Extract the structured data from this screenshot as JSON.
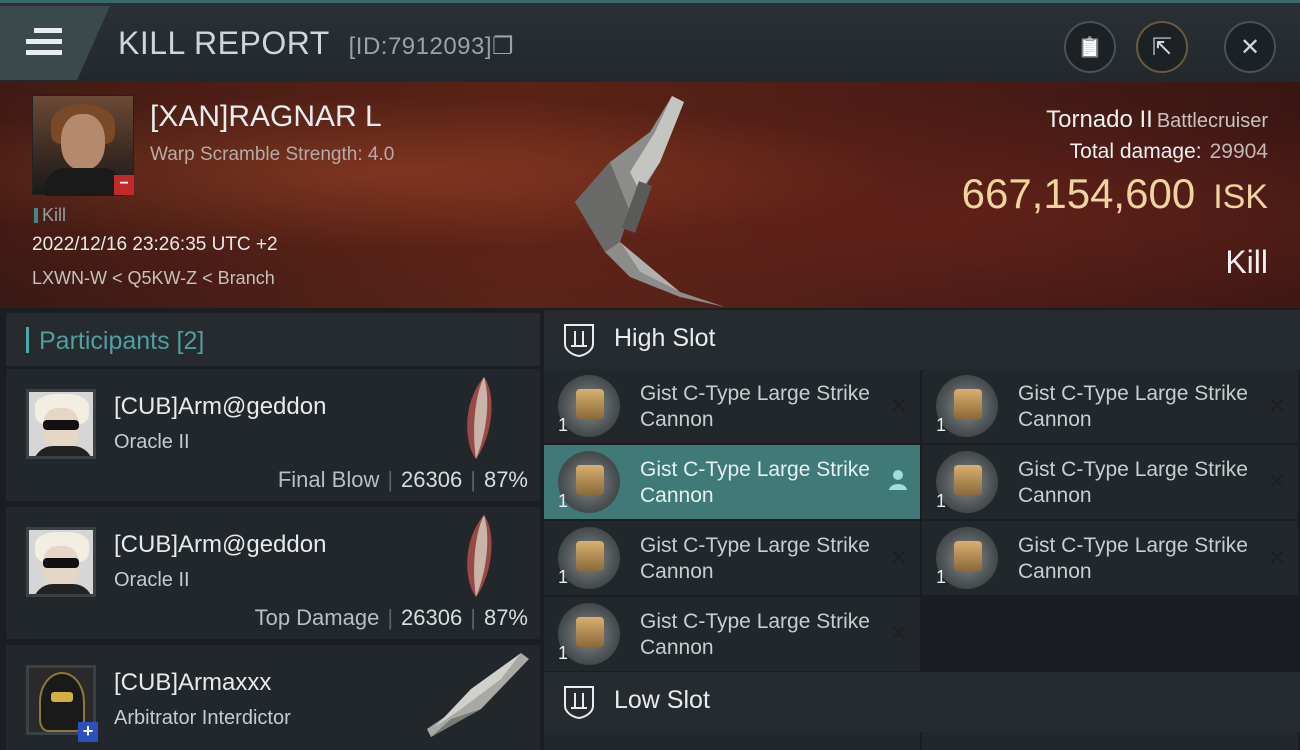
{
  "header": {
    "title": "KILL REPORT",
    "id_label": "[ID:7912093]",
    "copy_glyph": "❐",
    "clipboard_glyph": "📋",
    "share_glyph": "⇱",
    "close_glyph": "✕"
  },
  "victim": {
    "name": "[XAN]RAGNAR L",
    "scramble": "Warp Scramble Strength: 4.0",
    "kill_tag": "Kill",
    "datetime": "2022/12/16 23:26:35 UTC +2",
    "location": "LXWN-W < Q5KW-Z < Branch",
    "ship": "Tornado II",
    "ship_class": "Battlecruiser",
    "total_damage_label": "Total damage:",
    "total_damage": "29904",
    "isk_value": "667,154,600",
    "isk_unit": "ISK",
    "result": "Kill",
    "badge": "−"
  },
  "participants": {
    "header": "Participants [2]",
    "items": [
      {
        "name": "[CUB]Arm@geddon",
        "ship": "Oracle II",
        "label": "Final Blow",
        "damage": "26306",
        "percent": "87%"
      },
      {
        "name": "[CUB]Arm@geddon",
        "ship": "Oracle II",
        "label": "Top Damage",
        "damage": "26306",
        "percent": "87%"
      },
      {
        "name": "[CUB]Armaxxx",
        "ship": "Arbitrator Interdictor",
        "badge": "+"
      }
    ],
    "separator": "|"
  },
  "slots": {
    "high": {
      "label": "High Slot",
      "items": [
        {
          "name": "Gist C-Type Large Strike Cannon",
          "qty": "1",
          "action_icon": "✕"
        },
        {
          "name": "Gist C-Type Large Strike Cannon",
          "qty": "1",
          "action_icon": "✕"
        },
        {
          "name": "Gist C-Type Large Strike Cannon",
          "qty": "1",
          "action_icon": "👤"
        },
        {
          "name": "Gist C-Type Large Strike Cannon",
          "qty": "1",
          "action_icon": "✕"
        },
        {
          "name": "Gist C-Type Large Strike Cannon",
          "qty": "1",
          "action_icon": "✕"
        },
        {
          "name": "Gist C-Type Large Strike Cannon",
          "qty": "1",
          "action_icon": "✕"
        },
        {
          "name": "Gist C-Type Large Strike Cannon",
          "qty": "1",
          "action_icon": "✕"
        }
      ]
    },
    "low": {
      "label": "Low Slot"
    }
  },
  "colors": {
    "accent_teal": "#3f7a78",
    "isk_gold": "#f0d4a0",
    "kill_badge_red": "#c02a2a",
    "plus_badge_blue": "#2a50c0"
  }
}
